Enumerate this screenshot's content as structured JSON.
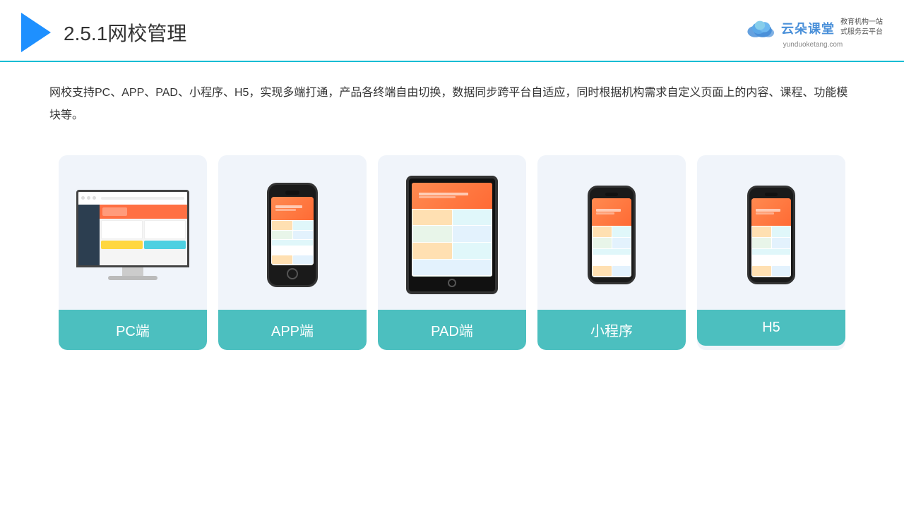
{
  "header": {
    "title_prefix": "2.5.1",
    "title_main": "网校管理",
    "logo_text": "云朵课堂",
    "logo_url": "yunduoketang.com",
    "logo_tagline": "教育机构一站\n式服务云平台"
  },
  "description": {
    "text": "网校支持PC、APP、PAD、小程序、H5，实现多端打通，产品各终端自由切换，数据同步跨平台自适应，同时根据机构需求自定义页面上的内容、课程、功能模块等。"
  },
  "cards": [
    {
      "id": "pc",
      "label": "PC端",
      "type": "pc"
    },
    {
      "id": "app",
      "label": "APP端",
      "type": "phone"
    },
    {
      "id": "pad",
      "label": "PAD端",
      "type": "tablet"
    },
    {
      "id": "miniapp",
      "label": "小程序",
      "type": "small-phone"
    },
    {
      "id": "h5",
      "label": "H5",
      "type": "small-phone"
    }
  ]
}
